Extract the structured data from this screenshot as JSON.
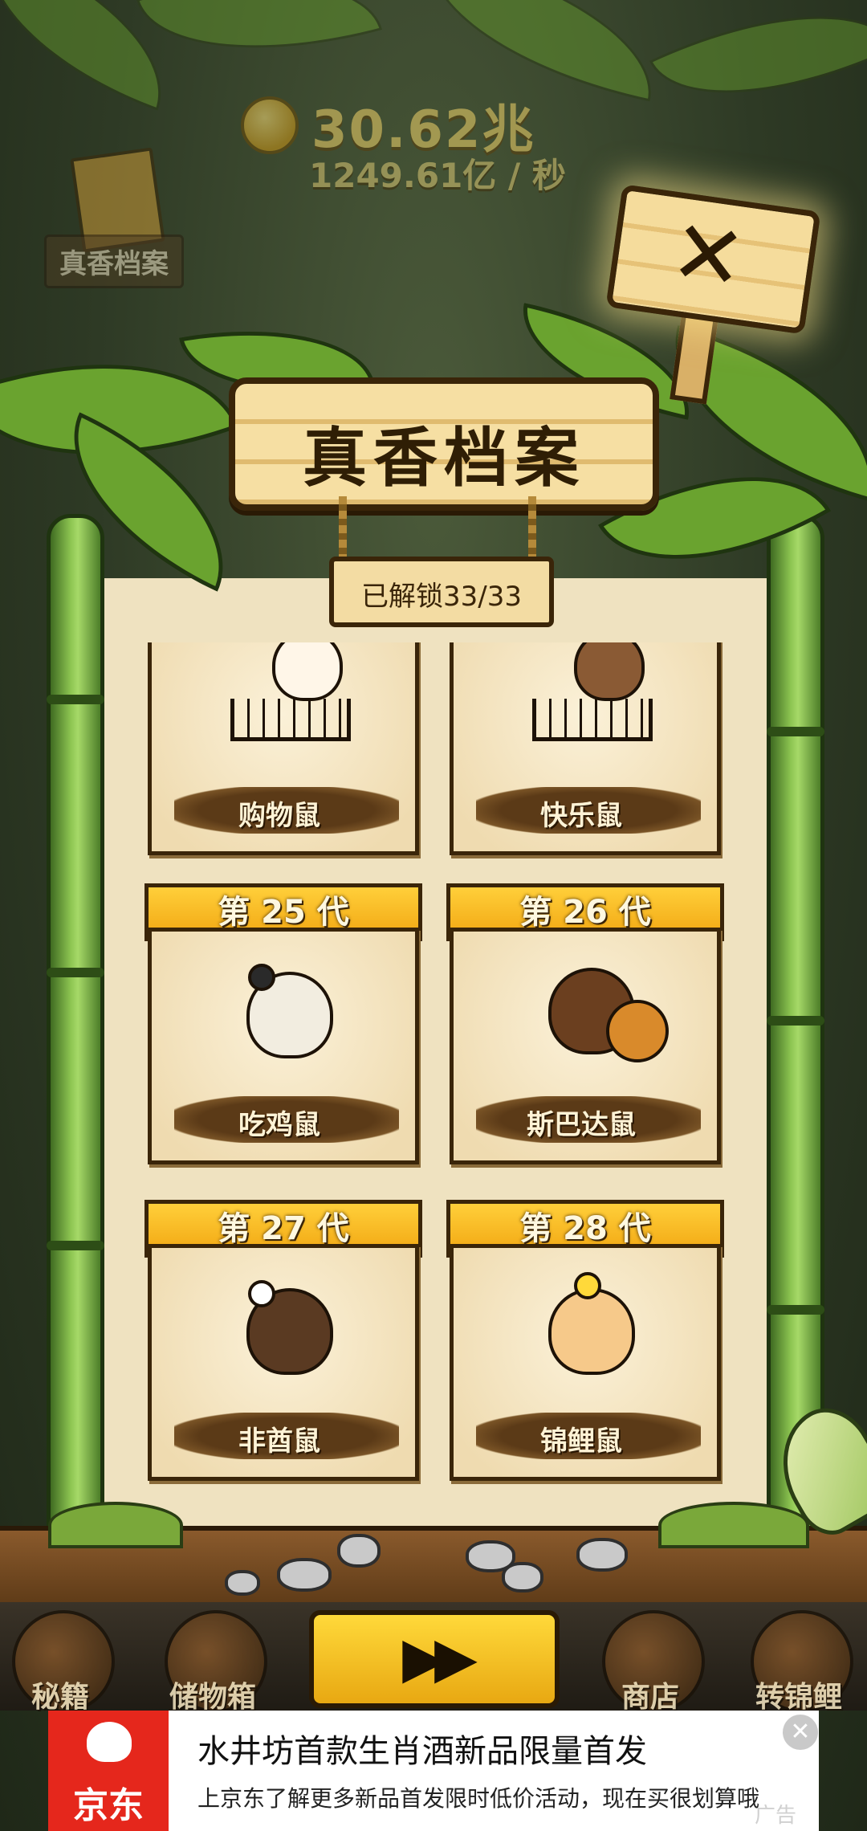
{
  "header": {
    "coin_amount": "30.62兆",
    "income_rate": "1249.61亿 / 秒",
    "bg_archive_label": "真香档案"
  },
  "archive": {
    "title": "真香档案",
    "unlock_status": "已解锁33/33",
    "close_symbol": "✕",
    "cards": [
      {
        "generation": "",
        "name": "购物鼠"
      },
      {
        "generation": "",
        "name": "快乐鼠"
      },
      {
        "generation": "第 25 代",
        "name": "吃鸡鼠"
      },
      {
        "generation": "第 26 代",
        "name": "斯巴达鼠"
      },
      {
        "generation": "第 27 代",
        "name": "非酋鼠"
      },
      {
        "generation": "第 28 代",
        "name": "锦鲤鼠"
      }
    ]
  },
  "bottom_nav": {
    "items": [
      {
        "label": "秘籍"
      },
      {
        "label": "储物箱"
      },
      {
        "label": "商店"
      },
      {
        "label": "转锦鲤"
      }
    ],
    "fast_forward_icon": "▶▶"
  },
  "ad": {
    "brand": "京东",
    "title": "水井坊首款生肖酒新品限量首发",
    "subtitle": "上京东了解更多新品首发限时低价活动，现在买很划算哦",
    "tag": "广告",
    "close_symbol": "✕"
  },
  "colors": {
    "gen_banner": "#f2a712",
    "wood": "#f3dca3",
    "bamboo": "#8cc451",
    "jd_red": "#e5271c"
  }
}
